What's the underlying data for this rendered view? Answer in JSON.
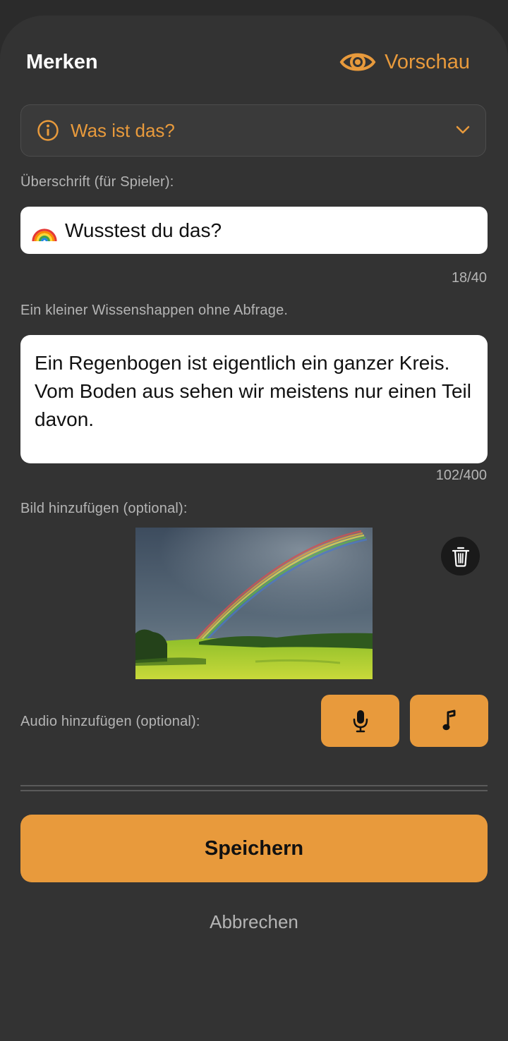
{
  "header": {
    "title": "Merken",
    "preview_label": "Vorschau"
  },
  "type_select": {
    "selected": "Was ist das?"
  },
  "heading_field": {
    "label": "Überschrift (für Spieler):",
    "value": "Wusstest du das?",
    "counter": "18/40"
  },
  "content_field": {
    "label": "Ein kleiner Wissenshappen ohne Abfrage.",
    "value": "Ein Regenbogen ist eigentlich ein ganzer Kreis. Vom Boden aus sehen wir meistens nur einen Teil davon.",
    "counter": "102/400"
  },
  "image_section": {
    "label": "Bild hinzufügen (optional):"
  },
  "audio_section": {
    "label": "Audio hinzufügen (optional):"
  },
  "actions": {
    "save_label": "Speichern",
    "cancel_label": "Abbrechen"
  },
  "colors": {
    "accent": "#e89a3c",
    "background": "#333333",
    "field": "#ffffff"
  },
  "icons": [
    "eye-icon",
    "info-icon",
    "chevron-down-icon",
    "rainbow-emoji",
    "trash-icon",
    "microphone-icon",
    "music-note-icon"
  ]
}
